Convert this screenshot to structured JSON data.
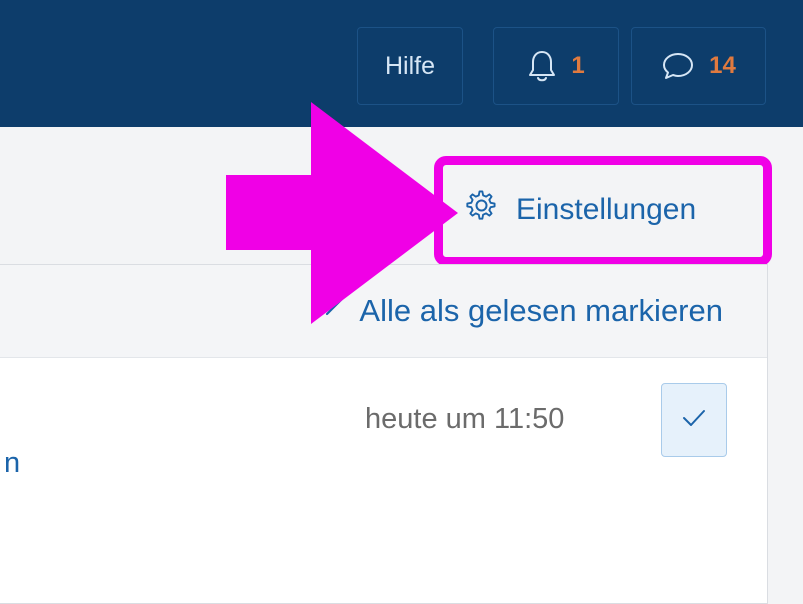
{
  "topbar": {
    "help_label": "Hilfe",
    "alerts": {
      "icon": "bell-icon",
      "count": "1"
    },
    "conversations": {
      "icon": "speech-bubble-icon",
      "count": "14"
    }
  },
  "settings": {
    "icon": "gear-icon",
    "label": "Einstellungen"
  },
  "alerts_panel": {
    "mark_all_read": {
      "icon": "double-check-icon",
      "label": "Alle als gelesen markieren"
    },
    "items": [
      {
        "text": "n",
        "time": "heute um 11:50",
        "mark_read_icon": "check-icon"
      }
    ]
  },
  "annotation": {
    "arrow_color": "#f000e6",
    "highlight_color": "#f000e6"
  },
  "colors": {
    "header": "#0d3d6b",
    "link": "#1b64aa",
    "count": "#e07a3f"
  }
}
